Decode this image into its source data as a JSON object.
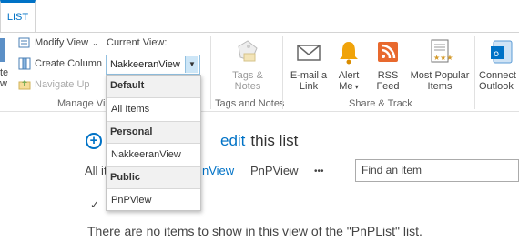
{
  "tabs": {
    "list_label": "LIST"
  },
  "manage_views": {
    "modify_view_label": "Modify View",
    "create_column_label": "Create Column",
    "navigate_up_label": "Navigate Up",
    "current_view_label": "Current View:",
    "current_view_value": "NakkeeranView",
    "group_label": "Manage Vi",
    "left_cut_1": "te",
    "left_cut_2": "w"
  },
  "view_dropdown": {
    "sections": [
      {
        "header": "Default",
        "items": [
          "All Items"
        ]
      },
      {
        "header": "Personal",
        "items": [
          "NakkeeranView"
        ]
      },
      {
        "header": "Public",
        "items": [
          "PnPView"
        ]
      }
    ]
  },
  "tags_notes": {
    "label_line1": "Tags &",
    "label_line2": "Notes",
    "group_label": "Tags and Notes"
  },
  "share_track": {
    "email_line1": "E-mail a",
    "email_line2": "Link",
    "alert_line1": "Alert",
    "alert_line2": "Me",
    "rss_line1": "RSS",
    "rss_line2": "Feed",
    "popular_line1": "Most Popular",
    "popular_line2": "Items",
    "group_label": "Share & Track"
  },
  "connect": {
    "line1": "Connect t",
    "line2": "Outlook"
  },
  "content": {
    "new_item_hidden_text": "edit",
    "new_item_suffix": "this list",
    "view_all_partial": "All it",
    "view_nakkeeran_partial": "nView",
    "view_pnp": "PnPView",
    "more_dots": "•••",
    "search_placeholder": "Find an item",
    "empty_message": "There are no items to show in this view of the \"PnPList\" list.",
    "check_mark": "✓"
  },
  "colors": {
    "accent": "#0072c6",
    "rss": "#e8692e",
    "alert": "#f0a30a"
  }
}
